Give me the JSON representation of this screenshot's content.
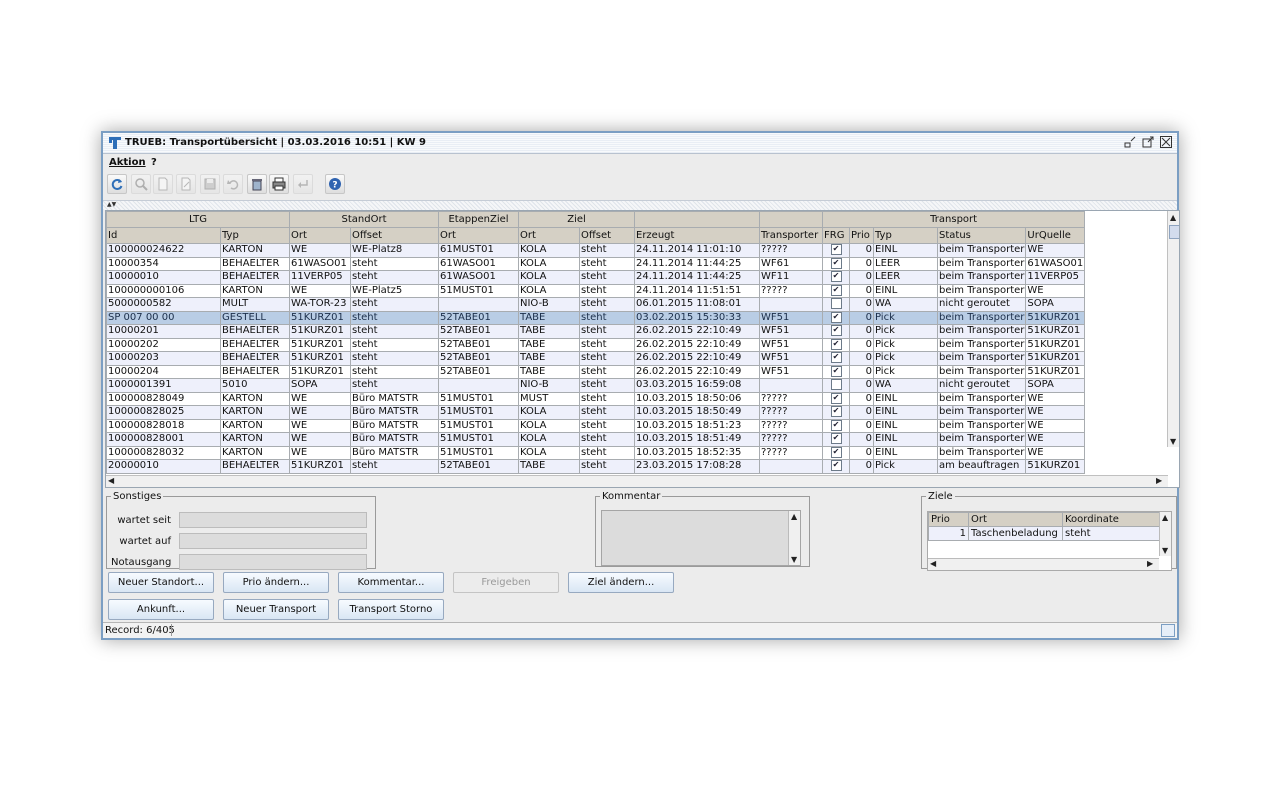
{
  "window": {
    "title": "TRUEB: Transportübersicht | 03.03.2016 10:51 | KW 9"
  },
  "menu": {
    "items": [
      "Aktion",
      "?"
    ]
  },
  "toolbar": {
    "icons": [
      "refresh-icon",
      "zoom-icon",
      "new-document-icon",
      "edit-document-icon",
      "save-icon",
      "undo-icon",
      "trash-icon",
      "print-icon",
      "return-icon",
      "help-icon"
    ]
  },
  "table": {
    "groups": [
      "LTG",
      "StandOrt",
      "EtappenZiel",
      "Ziel",
      "Transport"
    ],
    "columns": [
      "Id",
      "Typ",
      "Ort",
      "Offset",
      "Ort",
      "Ort",
      "Offset",
      "Erzeugt",
      "Transporter",
      "FRG",
      "Prio",
      "Typ",
      "Status",
      "UrQuelle"
    ],
    "rows": [
      {
        "id": "100000024622",
        "typ": "KARTON",
        "so_ort": "WE",
        "so_offset": "WE-Platz8",
        "ez_ort": "61MUST01",
        "z_ort": "KOLA",
        "z_offset": "steht",
        "erzeugt": "24.11.2014 11:01:10",
        "transporter": "?????",
        "frg": true,
        "prio": "0",
        "ttyp": "EINL",
        "status": "beim Transporter",
        "urquelle": "WE"
      },
      {
        "id": "10000354",
        "typ": "BEHAELTER",
        "so_ort": "61WASO01",
        "so_offset": "steht",
        "ez_ort": "61WASO01",
        "z_ort": "KOLA",
        "z_offset": "steht",
        "erzeugt": "24.11.2014 11:44:25",
        "transporter": "WF61",
        "frg": true,
        "prio": "0",
        "ttyp": "LEER",
        "status": "beim Transporter",
        "urquelle": "61WASO01"
      },
      {
        "id": "10000010",
        "typ": "BEHAELTER",
        "so_ort": "11VERP05",
        "so_offset": "steht",
        "ez_ort": "61WASO01",
        "z_ort": "KOLA",
        "z_offset": "steht",
        "erzeugt": "24.11.2014 11:44:25",
        "transporter": "WF11",
        "frg": true,
        "prio": "0",
        "ttyp": "LEER",
        "status": "beim Transporter",
        "urquelle": "11VERP05"
      },
      {
        "id": "100000000106",
        "typ": "KARTON",
        "so_ort": "WE",
        "so_offset": "WE-Platz5",
        "ez_ort": "51MUST01",
        "z_ort": "KOLA",
        "z_offset": "steht",
        "erzeugt": "24.11.2014 11:51:51",
        "transporter": "?????",
        "frg": true,
        "prio": "0",
        "ttyp": "EINL",
        "status": "beim Transporter",
        "urquelle": "WE"
      },
      {
        "id": "5000000582",
        "typ": "MULT",
        "so_ort": "WA-TOR-23",
        "so_offset": "steht",
        "ez_ort": "",
        "z_ort": "NIO-B",
        "z_offset": "steht",
        "erzeugt": "06.01.2015 11:08:01",
        "transporter": "",
        "frg": false,
        "prio": "0",
        "ttyp": "WA",
        "status": "nicht geroutet",
        "urquelle": "SOPA"
      },
      {
        "id": "SP 007 00 00",
        "typ": "GESTELL",
        "so_ort": "51KURZ01",
        "so_offset": "steht",
        "ez_ort": "52TABE01",
        "z_ort": "TABE",
        "z_offset": "steht",
        "erzeugt": "03.02.2015 15:30:33",
        "transporter": "WF51",
        "frg": true,
        "prio": "0",
        "ttyp": "Pick",
        "status": "beim Transporter",
        "urquelle": "51KURZ01",
        "selected": true
      },
      {
        "id": "10000201",
        "typ": "BEHAELTER",
        "so_ort": "51KURZ01",
        "so_offset": "steht",
        "ez_ort": "52TABE01",
        "z_ort": "TABE",
        "z_offset": "steht",
        "erzeugt": "26.02.2015 22:10:49",
        "transporter": "WF51",
        "frg": true,
        "prio": "0",
        "ttyp": "Pick",
        "status": "beim Transporter",
        "urquelle": "51KURZ01"
      },
      {
        "id": "10000202",
        "typ": "BEHAELTER",
        "so_ort": "51KURZ01",
        "so_offset": "steht",
        "ez_ort": "52TABE01",
        "z_ort": "TABE",
        "z_offset": "steht",
        "erzeugt": "26.02.2015 22:10:49",
        "transporter": "WF51",
        "frg": true,
        "prio": "0",
        "ttyp": "Pick",
        "status": "beim Transporter",
        "urquelle": "51KURZ01"
      },
      {
        "id": "10000203",
        "typ": "BEHAELTER",
        "so_ort": "51KURZ01",
        "so_offset": "steht",
        "ez_ort": "52TABE01",
        "z_ort": "TABE",
        "z_offset": "steht",
        "erzeugt": "26.02.2015 22:10:49",
        "transporter": "WF51",
        "frg": true,
        "prio": "0",
        "ttyp": "Pick",
        "status": "beim Transporter",
        "urquelle": "51KURZ01"
      },
      {
        "id": "10000204",
        "typ": "BEHAELTER",
        "so_ort": "51KURZ01",
        "so_offset": "steht",
        "ez_ort": "52TABE01",
        "z_ort": "TABE",
        "z_offset": "steht",
        "erzeugt": "26.02.2015 22:10:49",
        "transporter": "WF51",
        "frg": true,
        "prio": "0",
        "ttyp": "Pick",
        "status": "beim Transporter",
        "urquelle": "51KURZ01"
      },
      {
        "id": "1000001391",
        "typ": "5010",
        "so_ort": "SOPA",
        "so_offset": "steht",
        "ez_ort": "",
        "z_ort": "NIO-B",
        "z_offset": "steht",
        "erzeugt": "03.03.2015 16:59:08",
        "transporter": "",
        "frg": false,
        "prio": "0",
        "ttyp": "WA",
        "status": "nicht geroutet",
        "urquelle": "SOPA"
      },
      {
        "id": "100000828049",
        "typ": "KARTON",
        "so_ort": "WE",
        "so_offset": "Büro MATSTR",
        "ez_ort": "51MUST01",
        "z_ort": "MUST",
        "z_offset": "steht",
        "erzeugt": "10.03.2015 18:50:06",
        "transporter": "?????",
        "frg": true,
        "prio": "0",
        "ttyp": "EINL",
        "status": "beim Transporter",
        "urquelle": "WE"
      },
      {
        "id": "100000828025",
        "typ": "KARTON",
        "so_ort": "WE",
        "so_offset": "Büro MATSTR",
        "ez_ort": "51MUST01",
        "z_ort": "KOLA",
        "z_offset": "steht",
        "erzeugt": "10.03.2015 18:50:49",
        "transporter": "?????",
        "frg": true,
        "prio": "0",
        "ttyp": "EINL",
        "status": "beim Transporter",
        "urquelle": "WE"
      },
      {
        "id": "100000828018",
        "typ": "KARTON",
        "so_ort": "WE",
        "so_offset": "Büro MATSTR",
        "ez_ort": "51MUST01",
        "z_ort": "KOLA",
        "z_offset": "steht",
        "erzeugt": "10.03.2015 18:51:23",
        "transporter": "?????",
        "frg": true,
        "prio": "0",
        "ttyp": "EINL",
        "status": "beim Transporter",
        "urquelle": "WE"
      },
      {
        "id": "100000828001",
        "typ": "KARTON",
        "so_ort": "WE",
        "so_offset": "Büro MATSTR",
        "ez_ort": "51MUST01",
        "z_ort": "KOLA",
        "z_offset": "steht",
        "erzeugt": "10.03.2015 18:51:49",
        "transporter": "?????",
        "frg": true,
        "prio": "0",
        "ttyp": "EINL",
        "status": "beim Transporter",
        "urquelle": "WE"
      },
      {
        "id": "100000828032",
        "typ": "KARTON",
        "so_ort": "WE",
        "so_offset": "Büro MATSTR",
        "ez_ort": "51MUST01",
        "z_ort": "KOLA",
        "z_offset": "steht",
        "erzeugt": "10.03.2015 18:52:35",
        "transporter": "?????",
        "frg": true,
        "prio": "0",
        "ttyp": "EINL",
        "status": "beim Transporter",
        "urquelle": "WE"
      },
      {
        "id": "20000010",
        "typ": "BEHAELTER",
        "so_ort": "51KURZ01",
        "so_offset": "steht",
        "ez_ort": "52TABE01",
        "z_ort": "TABE",
        "z_offset": "steht",
        "erzeugt": "23.03.2015 17:08:28",
        "transporter": "",
        "frg": true,
        "prio": "0",
        "ttyp": "Pick",
        "status": "am beauftragen",
        "urquelle": "51KURZ01"
      }
    ]
  },
  "sonstiges": {
    "title": "Sonstiges",
    "wartet_seit": "wartet seit",
    "wartet_auf": "wartet auf",
    "notausgang": "Notausgang"
  },
  "kommentar": {
    "title": "Kommentar"
  },
  "ziele": {
    "title": "Ziele",
    "columns": [
      "Prio",
      "Ort",
      "Koordinate"
    ],
    "rows": [
      {
        "prio": "1",
        "ort": "Taschenbeladung",
        "koordinate": "steht"
      }
    ]
  },
  "buttons": {
    "neuer_standort": "Neuer Standort...",
    "prio_aendern": "Prio ändern...",
    "kommentar": "Kommentar...",
    "freigeben": "Freigeben",
    "ziel_aendern": "Ziel ändern...",
    "ankunft": "Ankunft...",
    "neuer_transport": "Neuer Transport",
    "transport_storno": "Transport Storno"
  },
  "status": {
    "record": "Record: 6/405"
  }
}
